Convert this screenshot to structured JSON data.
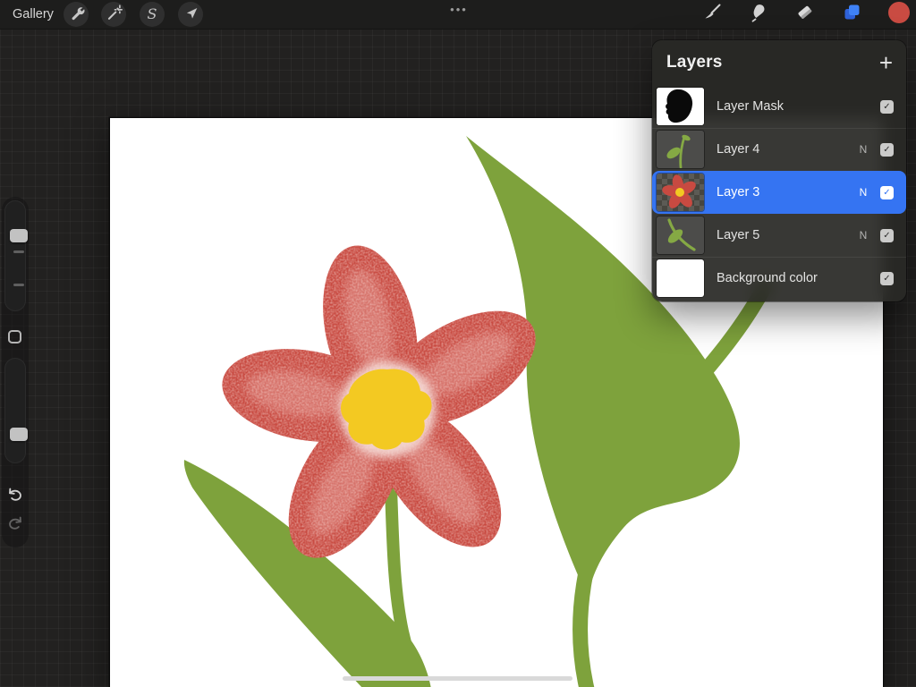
{
  "topbar": {
    "gallery_label": "Gallery",
    "menu_dots": "•••",
    "left_tools": [
      "wrench",
      "adjustments-wand",
      "selection-s",
      "transform-arrow"
    ],
    "right_tools": [
      "brush",
      "smudge",
      "eraser",
      "layers",
      "color-swatch"
    ]
  },
  "sidebar": {
    "controls": [
      "brush-size-slider",
      "modify-button",
      "opacity-slider",
      "undo",
      "redo"
    ]
  },
  "layers_panel": {
    "title": "Layers",
    "add_button": "+",
    "check_glyph": "✓",
    "rows": [
      {
        "name": "Layer Mask",
        "blend": "",
        "checked": true,
        "selected": false,
        "thumb": "black-mask-on-white"
      },
      {
        "name": "Layer 4",
        "blend": "N",
        "checked": true,
        "selected": false,
        "thumb": "green-stem-sketch"
      },
      {
        "name": "Layer 3",
        "blend": "N",
        "checked": true,
        "selected": true,
        "thumb": "red-flower-on-transparency"
      },
      {
        "name": "Layer 5",
        "blend": "N",
        "checked": true,
        "selected": false,
        "thumb": "green-leaf-sketch"
      },
      {
        "name": "Background color",
        "blend": "",
        "checked": true,
        "selected": false,
        "thumb": "white"
      }
    ]
  },
  "canvas": {
    "artwork": "red textured five-petal flower with yellow center, green stems and leaves on white canvas",
    "home_indicator": true
  },
  "colors": {
    "selection_blue": "#3574f2",
    "layers_icon_blue": "#3f82f6",
    "petal_red": "#c84a41",
    "petal_speckle": "#eda89f",
    "center_yellow": "#f3c922",
    "leaf_green": "#7ea23c",
    "color_swatch_red": "#c94b42",
    "canvas_white": "#ffffff",
    "workspace_bg": "#222120",
    "panel_bg": "#292926"
  }
}
